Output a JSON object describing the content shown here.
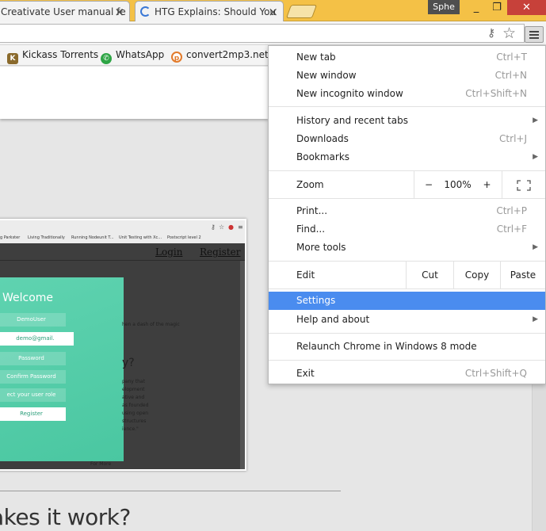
{
  "tabs": [
    {
      "title": "Creativate User manual fe"
    },
    {
      "title": "HTG Explains: Should You"
    }
  ],
  "profile_name": "Sphe",
  "window_controls": {
    "minimize": "_",
    "maximize": "❐",
    "close": "✕"
  },
  "bookmarks": [
    {
      "label": "Kickass Torrents",
      "icon": "shield-icon",
      "color": "#8a6a2c"
    },
    {
      "label": "WhatsApp",
      "icon": "whatsapp-icon",
      "color": "#2ea545"
    },
    {
      "label": "convert2mp3.net",
      "icon": "convert-icon",
      "color": "#e27a2a"
    }
  ],
  "menu": {
    "new_tab": {
      "label": "New tab",
      "shortcut": "Ctrl+T"
    },
    "new_window": {
      "label": "New window",
      "shortcut": "Ctrl+N"
    },
    "new_incognito": {
      "label": "New incognito window",
      "shortcut": "Ctrl+Shift+N"
    },
    "history": {
      "label": "History and recent tabs"
    },
    "downloads": {
      "label": "Downloads",
      "shortcut": "Ctrl+J"
    },
    "bookmarks": {
      "label": "Bookmarks"
    },
    "zoom": {
      "label": "Zoom",
      "minus": "−",
      "value": "100%",
      "plus": "+"
    },
    "print": {
      "label": "Print...",
      "shortcut": "Ctrl+P"
    },
    "find": {
      "label": "Find...",
      "shortcut": "Ctrl+F"
    },
    "more_tools": {
      "label": "More tools"
    },
    "edit": {
      "label": "Edit",
      "cut": "Cut",
      "copy": "Copy",
      "paste": "Paste"
    },
    "settings": {
      "label": "Settings"
    },
    "help": {
      "label": "Help and about"
    },
    "relaunch": {
      "label": "Relaunch Chrome in Windows 8 mode"
    },
    "exit": {
      "label": "Exit",
      "shortcut": "Ctrl+Shift+Q"
    }
  },
  "embed": {
    "bookmarks": [
      "g Parkster",
      "Living Traditionally",
      "Running Nodeunit T...",
      "Unit Testing with Xc...",
      "Postscript level 2"
    ],
    "nav_login": "Login",
    "nav_register": "Register",
    "welcome": "Welcome",
    "fields": [
      "DemoUser",
      "demo@gmail.",
      "Password",
      "Confirm Password",
      "ect your user role",
      "Register"
    ],
    "snippets": [
      "hen a dash of the magic",
      "y?",
      "pany that",
      "elopment",
      "ative and",
      "as founded",
      "using open",
      "structures",
      "ience.\"",
      "For More"
    ]
  },
  "page": {
    "heading": "akes it work?"
  }
}
